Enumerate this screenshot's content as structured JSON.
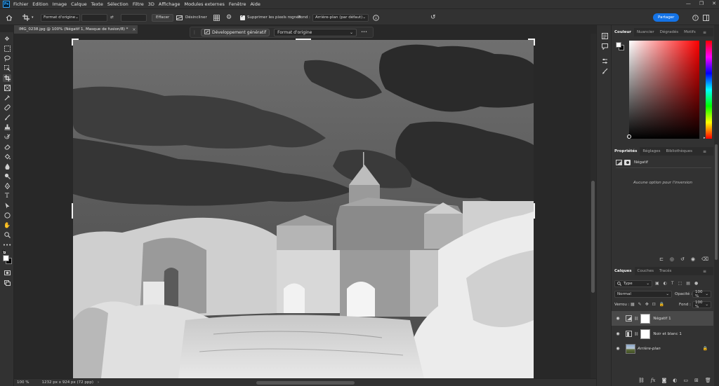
{
  "app": {
    "logo": "Ps",
    "menu": [
      "Fichier",
      "Edition",
      "Image",
      "Calque",
      "Texte",
      "Sélection",
      "Filtre",
      "3D",
      "Affichage",
      "Modules externes",
      "Fenêtre",
      "Aide"
    ],
    "window_controls": [
      "—",
      "❐",
      "✕"
    ]
  },
  "options_bar": {
    "format_select": "Format d'origine",
    "clear_label": "Effacer",
    "straighten_label": "Désincliner",
    "delete_cropped_label": "Supprimer les pixels rognés",
    "fill_label": "Fond :",
    "fill_select": "Arrière-plan (par défaut)",
    "share_label": "Partager"
  },
  "document": {
    "tab_title": "IMG_0238.jpg @ 100% (Négatif 1, Masque de fusion/8) *",
    "tab_close": "×"
  },
  "context_bar": {
    "generative_label": "Développement génératif",
    "format_label": "Format d'origine",
    "more_label": "•••"
  },
  "status": {
    "zoom": "100 %",
    "doc_info": "1232 px x 924 px (72 ppp)"
  },
  "color_panel": {
    "tabs": [
      "Couleur",
      "Nuancier",
      "Dégradés",
      "Motifs"
    ],
    "active_tab": "Couleur"
  },
  "properties_panel": {
    "tabs": [
      "Propriétés",
      "Réglages",
      "Bibliothèques"
    ],
    "header_label": "Négatif",
    "message": "Aucune option pour l'inversion"
  },
  "layers_panel": {
    "tabs": [
      "Calques",
      "Couches",
      "Tracés"
    ],
    "filter_label": "Type",
    "blend_mode": "Normal",
    "opacity_label": "Opacité :",
    "opacity_value": "100 %",
    "lock_label": "Verrou :",
    "fill_label": "Fond :",
    "fill_value": "100 %",
    "layers": [
      {
        "name": "Négatif 1",
        "selected": true
      },
      {
        "name": "Noir et blanc 1",
        "selected": false
      },
      {
        "name": "Arrière-plan",
        "selected": false
      }
    ]
  },
  "colors": {
    "accent": "#1473e6",
    "panel_bg": "#323232",
    "canvas_bg": "#282828"
  }
}
